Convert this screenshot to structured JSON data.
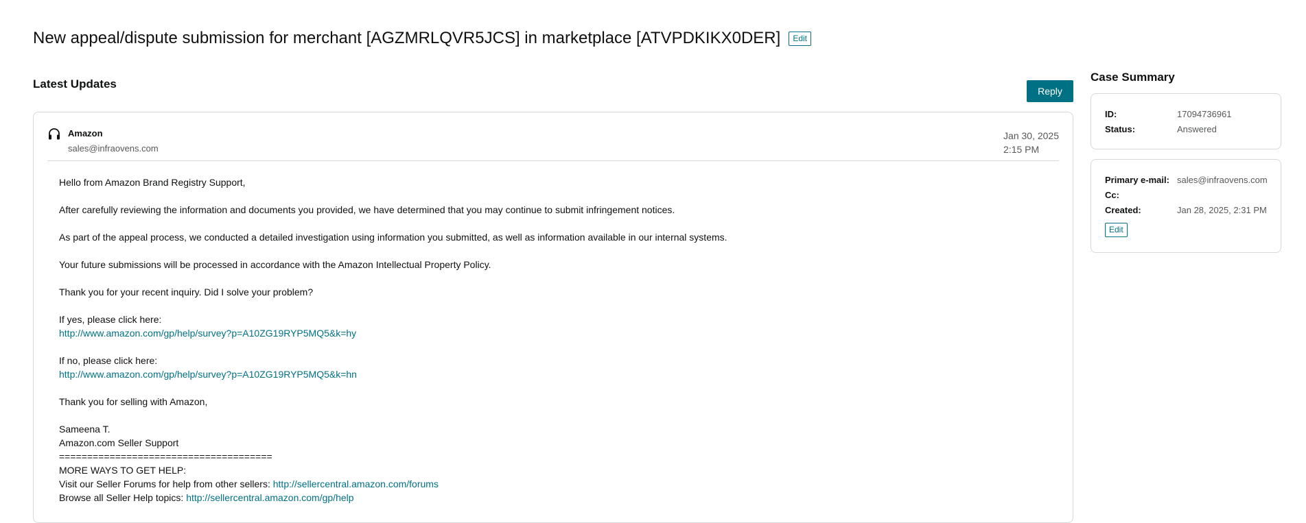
{
  "page": {
    "title": "New appeal/dispute submission for merchant [AGZMRLQVR5JCS] in marketplace [ATVPDKIKX0DER]",
    "title_edit_label": "Edit"
  },
  "updates": {
    "heading": "Latest Updates",
    "reply_label": "Reply"
  },
  "message": {
    "sender": "Amazon",
    "email": "sales@infraovens.com",
    "date": "Jan 30, 2025",
    "time": "2:15 PM",
    "greeting": "Hello from Amazon Brand Registry Support,",
    "para1": "After carefully reviewing the information and documents you provided, we have determined that you may continue to submit infringement notices.",
    "para2": "As part of the appeal process, we conducted a detailed investigation using information you submitted, as well as information available in our internal systems.",
    "para3": "Your future submissions will be processed in accordance with the Amazon Intellectual Property Policy.",
    "para4": "Thank you for your recent inquiry. Did I solve your problem?",
    "yes_text": "If yes, please click here:",
    "yes_link": "http://www.amazon.com/gp/help/survey?p=A10ZG19RYP5MQ5&k=hy",
    "no_text": "If no, please click here:",
    "no_link": "http://www.amazon.com/gp/help/survey?p=A10ZG19RYP5MQ5&k=hn",
    "closing": "Thank you for selling with Amazon,",
    "signer": "Sameena T.",
    "signer_org": "Amazon.com Seller Support",
    "divider": "======================================",
    "more_help": "MORE WAYS TO GET HELP:",
    "forums_text": "Visit our Seller Forums for help from other sellers:",
    "forums_link": "http://sellercentral.amazon.com/forums",
    "browse_text": "Browse all Seller Help topics:",
    "browse_link": "http://sellercentral.amazon.com/gp/help"
  },
  "summary": {
    "heading": "Case Summary",
    "id_label": "ID:",
    "id_value": "17094736961",
    "status_label": "Status:",
    "status_value": "Answered",
    "primary_email_label": "Primary e-mail:",
    "primary_email_value": "sales@infraovens.com",
    "cc_label": "Cc:",
    "created_label": "Created:",
    "created_value": "Jan 28, 2025, 2:31 PM",
    "edit_label": "Edit"
  },
  "colors": {
    "accent": "#007185",
    "border": "#d5d9d9",
    "muted": "#565959"
  },
  "icons": {
    "sender": "headset-icon"
  }
}
